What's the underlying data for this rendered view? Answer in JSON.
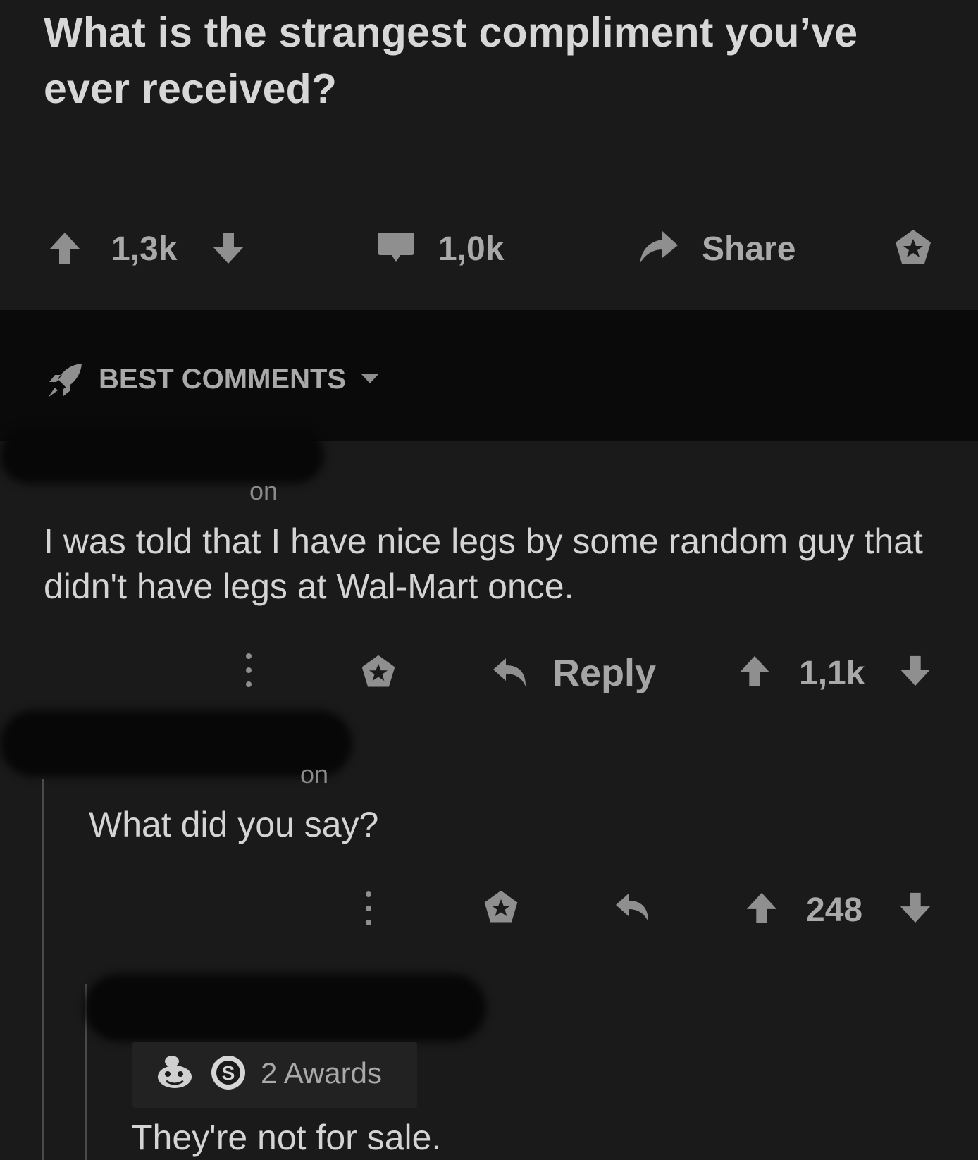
{
  "post": {
    "title": "What is the strangest compliment you’ve ever received?",
    "upvotes": "1,3k",
    "comments": "1,0k",
    "share_label": "Share"
  },
  "sort": {
    "label": "BEST COMMENTS"
  },
  "comments": [
    {
      "timestamp": "on",
      "body": "I was told that I have nice legs by some random guy that didn't have legs at Wal-Mart once.",
      "reply_label": "Reply",
      "score": "1,1k"
    },
    {
      "timestamp": "on",
      "body": "What did you say?",
      "score": "248"
    },
    {
      "awards": "2 Awards",
      "body": "They're not for sale."
    }
  ],
  "colors": {
    "background": "#1a1a1b",
    "bar": "#0a0a0a",
    "icon": "#8f8f8f"
  }
}
